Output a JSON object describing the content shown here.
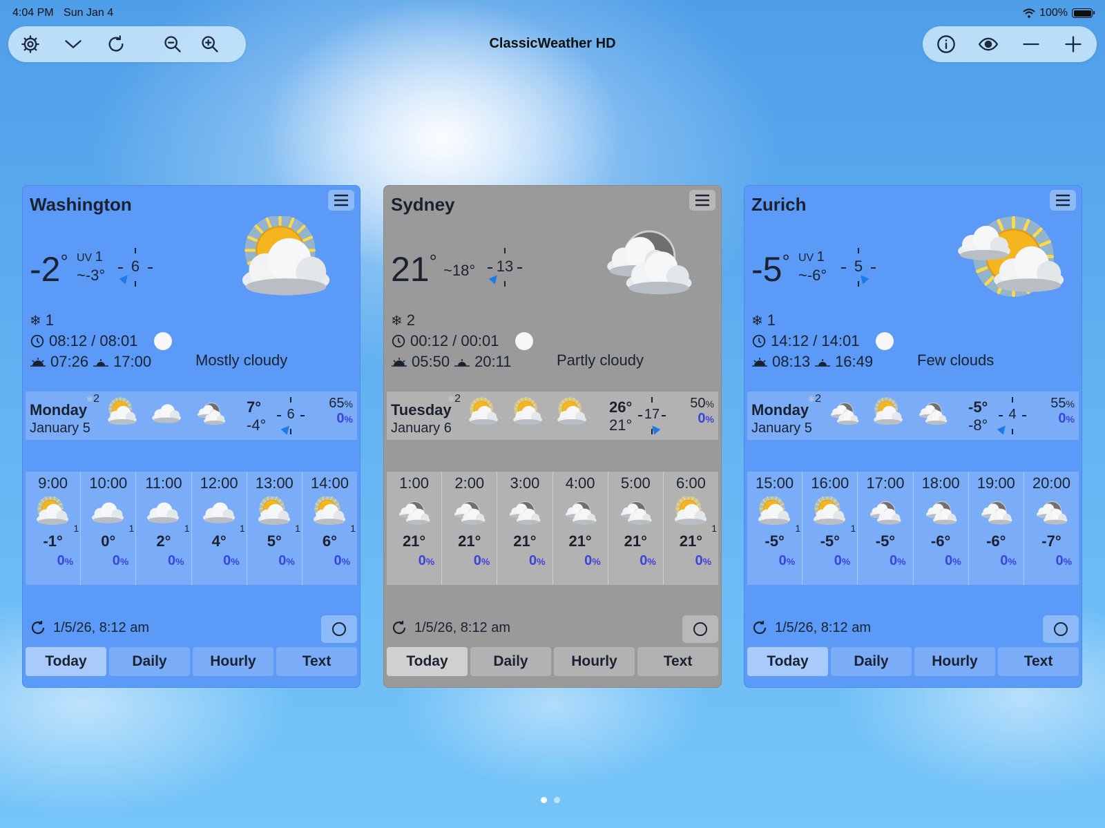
{
  "status_bar": {
    "time": "4:04 PM",
    "date": "Sun Jan 4",
    "battery": "100%",
    "battery_level": 1.0
  },
  "app_title": "ClassicWeather HD",
  "toolbar_left": [
    "gear-icon",
    "chevron-down-icon",
    "refresh-icon",
    "zoom-out-icon",
    "zoom-in-icon"
  ],
  "toolbar_right": [
    "info-icon",
    "eye-icon",
    "minus-icon",
    "plus-icon"
  ],
  "cards": [
    {
      "city": "Washington",
      "theme": "blue",
      "temp": "-2",
      "uv_label": "UV",
      "uv": "1",
      "feels": "~-3°",
      "wind": "6",
      "icon": "sun-cloud",
      "snow": "1",
      "clock": "08:12 / 08:01",
      "sunrise": "07:26",
      "sunset": "17:00",
      "condition": "Mostly cloudy",
      "day": {
        "name": "Monday",
        "date": "January 5",
        "snow": "2",
        "icons": [
          "sun-cloud",
          "cloud",
          "moon-cloud"
        ],
        "hi": "7°",
        "lo": "-4°",
        "wind": "6",
        "humidity": "65",
        "rain": "0"
      },
      "hours": [
        {
          "time": "9:00",
          "icon": "sun-cloud",
          "sup": "1",
          "temp": "-1°",
          "rain": "0"
        },
        {
          "time": "10:00",
          "icon": "cloud",
          "sup": "1",
          "temp": "0°",
          "rain": "0"
        },
        {
          "time": "11:00",
          "icon": "cloud",
          "sup": "1",
          "temp": "2°",
          "rain": "0"
        },
        {
          "time": "12:00",
          "icon": "cloud",
          "sup": "1",
          "temp": "4°",
          "rain": "0"
        },
        {
          "time": "13:00",
          "icon": "sun-cloud",
          "sup": "1",
          "temp": "5°",
          "rain": "0"
        },
        {
          "time": "14:00",
          "icon": "sun-cloud",
          "sup": "1",
          "temp": "6°",
          "rain": "0"
        }
      ],
      "updated": "1/5/26, 8:12 am",
      "tabs": [
        "Today",
        "Daily",
        "Hourly",
        "Text"
      ]
    },
    {
      "city": "Sydney",
      "theme": "gray",
      "temp": "21",
      "uv_label": "",
      "uv": "",
      "feels": "~18°",
      "wind": "13",
      "icon": "moon-cloud",
      "snow": "2",
      "clock": "00:12 / 00:01",
      "sunrise": "05:50",
      "sunset": "20:11",
      "condition": "Partly cloudy",
      "day": {
        "name": "Tuesday",
        "date": "January 6",
        "snow": "2",
        "icons": [
          "sun-cloud",
          "sun-cloud",
          "sun-cloud"
        ],
        "hi": "26°",
        "lo": "21°",
        "wind": "17",
        "humidity": "50",
        "rain": "0"
      },
      "hours": [
        {
          "time": "1:00",
          "icon": "moon-cloud",
          "sup": "",
          "temp": "21°",
          "rain": "0"
        },
        {
          "time": "2:00",
          "icon": "moon-cloud",
          "sup": "",
          "temp": "21°",
          "rain": "0"
        },
        {
          "time": "3:00",
          "icon": "moon-cloud",
          "sup": "",
          "temp": "21°",
          "rain": "0"
        },
        {
          "time": "4:00",
          "icon": "moon-cloud",
          "sup": "",
          "temp": "21°",
          "rain": "0"
        },
        {
          "time": "5:00",
          "icon": "moon-cloud",
          "sup": "",
          "temp": "21°",
          "rain": "0"
        },
        {
          "time": "6:00",
          "icon": "sun-cloud",
          "sup": "1",
          "temp": "21°",
          "rain": "0"
        }
      ],
      "updated": "1/5/26, 8:12 am",
      "tabs": [
        "Today",
        "Daily",
        "Hourly",
        "Text"
      ]
    },
    {
      "city": "Zurich",
      "theme": "blue",
      "temp": "-5",
      "uv_label": "UV",
      "uv": "1",
      "feels": "~-6°",
      "wind": "5",
      "icon": "sun-cloud-big",
      "snow": "1",
      "clock": "14:12 / 14:01",
      "sunrise": "08:13",
      "sunset": "16:49",
      "condition": "Few clouds",
      "day": {
        "name": "Monday",
        "date": "January 5",
        "snow": "2",
        "icons": [
          "moon-cloud",
          "sun-cloud",
          "moon-cloud"
        ],
        "hi": "-5°",
        "lo": "-8°",
        "wind": "4",
        "humidity": "55",
        "rain": "0"
      },
      "hours": [
        {
          "time": "15:00",
          "icon": "sun-cloud",
          "sup": "1",
          "temp": "-5°",
          "rain": "0"
        },
        {
          "time": "16:00",
          "icon": "sun-cloud",
          "sup": "1",
          "temp": "-5°",
          "rain": "0"
        },
        {
          "time": "17:00",
          "icon": "moon-cloud",
          "sup": "",
          "temp": "-5°",
          "rain": "0"
        },
        {
          "time": "18:00",
          "icon": "moon-cloud",
          "sup": "",
          "temp": "-6°",
          "rain": "0"
        },
        {
          "time": "19:00",
          "icon": "moon-cloud",
          "sup": "",
          "temp": "-6°",
          "rain": "0"
        },
        {
          "time": "20:00",
          "icon": "moon-cloud",
          "sup": "",
          "temp": "-7°",
          "rain": "0"
        }
      ],
      "updated": "1/5/26, 8:12 am",
      "tabs": [
        "Today",
        "Daily",
        "Hourly",
        "Text"
      ]
    }
  ],
  "pager": {
    "pages": 2,
    "current": 0
  }
}
